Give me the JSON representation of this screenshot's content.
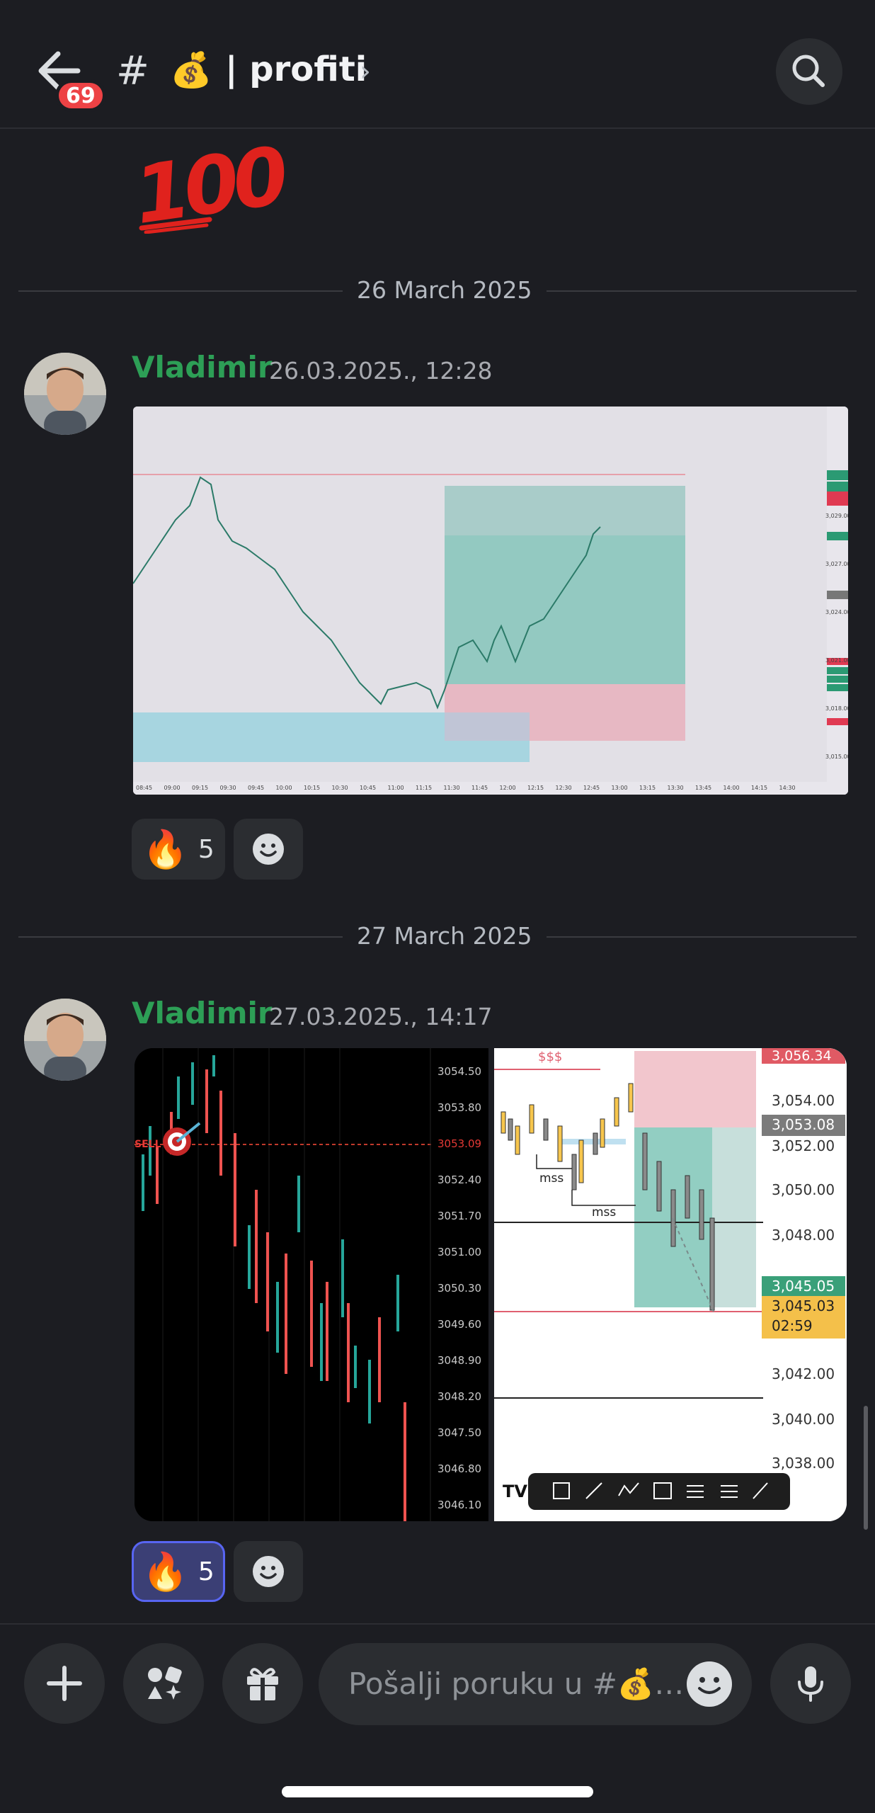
{
  "header": {
    "unread_count": "69",
    "channel_prefix": "#",
    "channel_emoji": "💰",
    "channel_name": "| profiti",
    "chevron": "›"
  },
  "feed": {
    "sticker_text": "100",
    "messages": [
      {
        "date_divider": "26 March 2025",
        "author": "Vladimir",
        "timestamp": "26.03.2025., 12:28",
        "attachment_icon": "chart-screenshot-icon",
        "reactions": [
          {
            "emoji": "🔥",
            "count": "5",
            "active": false
          }
        ]
      },
      {
        "date_divider": "27 March 2025",
        "author": "Vladimir",
        "timestamp": "27.03.2025., 14:17",
        "attachment_icon": "chart-screenshot-icon",
        "reactions": [
          {
            "emoji": "🔥",
            "count": "5",
            "active": true
          }
        ]
      }
    ],
    "chart1_price_labels": [
      "3,029.00",
      "3,027.00",
      "3,024.00",
      "3,021.00",
      "3,018.00",
      "3,015.00"
    ],
    "chart1_time_labels": [
      "08:45",
      "09:00",
      "09:15",
      "09:30",
      "09:45",
      "10:00",
      "10:15",
      "10:30",
      "10:45",
      "11:00",
      "11:15",
      "11:30",
      "11:45",
      "12:00",
      "12:15",
      "12:30",
      "12:45",
      "13:00",
      "13:15",
      "13:30",
      "13:45",
      "14:00",
      "14:15",
      "14:30"
    ],
    "chart2_price_labels": [
      "3054.50",
      "3053.80",
      "3053.09",
      "3052.40",
      "3051.70",
      "3051.00",
      "3050.30",
      "3049.60",
      "3048.90",
      "3048.20",
      "3047.50",
      "3046.80",
      "3046.10"
    ],
    "chart2_sell_label": "SELL",
    "chart3_price_labels": [
      "3,054.00",
      "3,052.00",
      "3,050.00",
      "3,048.00",
      "3,042.00",
      "3,040.00",
      "3,038.00"
    ],
    "chart3_top_label": "3,056.34",
    "chart3_grey_label": "3,053.08",
    "chart3_green_label": "3,045.05",
    "chart3_yellow_price": "3,045.03",
    "chart3_yellow_time": "02:59",
    "chart3_liquidity": "$$$",
    "chart3_mss_1": "mss",
    "chart3_mss_2": "mss",
    "chart3_logo": "TV"
  },
  "composer": {
    "placeholder": "Pošalji poruku u #💰…"
  },
  "colors": {
    "accent": "#5865f2",
    "username": "#2d9f56",
    "badge": "#ed4245",
    "background": "#1c1d22"
  }
}
